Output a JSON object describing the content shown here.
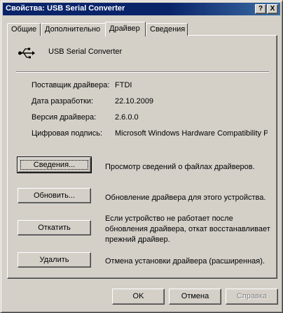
{
  "window": {
    "title": "Свойства: USB Serial Converter"
  },
  "titlebar_buttons": {
    "help": "?",
    "close": "X"
  },
  "tabs": [
    {
      "label": "Общие"
    },
    {
      "label": "Дополнительно"
    },
    {
      "label": "Драйвер",
      "active": true
    },
    {
      "label": "Сведения"
    }
  ],
  "device": {
    "icon": "usb-icon",
    "name": "USB Serial Converter"
  },
  "info": [
    {
      "label": "Поставщик драйвера:",
      "value": "FTDI"
    },
    {
      "label": "Дата разработки:",
      "value": "22.10.2009"
    },
    {
      "label": "Версия драйвера:",
      "value": "2.6.0.0"
    },
    {
      "label": "Цифровая подпись:",
      "value": "Microsoft Windows Hardware Compatibility Publ"
    }
  ],
  "actions": [
    {
      "button": "Сведения...",
      "description": "Просмотр сведений о файлах драйверов."
    },
    {
      "button": "Обновить...",
      "description": "Обновление драйвера для этого устройства."
    },
    {
      "button": "Откатить",
      "description": "Если устройство не работает после обновления драйвера, откат восстанавливает прежний драйвер."
    },
    {
      "button": "Удалить",
      "description": "Отмена установки драйвера (расширенная)."
    }
  ],
  "dialog_buttons": {
    "ok": "OK",
    "cancel": "Отмена",
    "help": "Справка"
  },
  "colors": {
    "titlebar": "#0a246a",
    "face": "#d4d0c8"
  }
}
